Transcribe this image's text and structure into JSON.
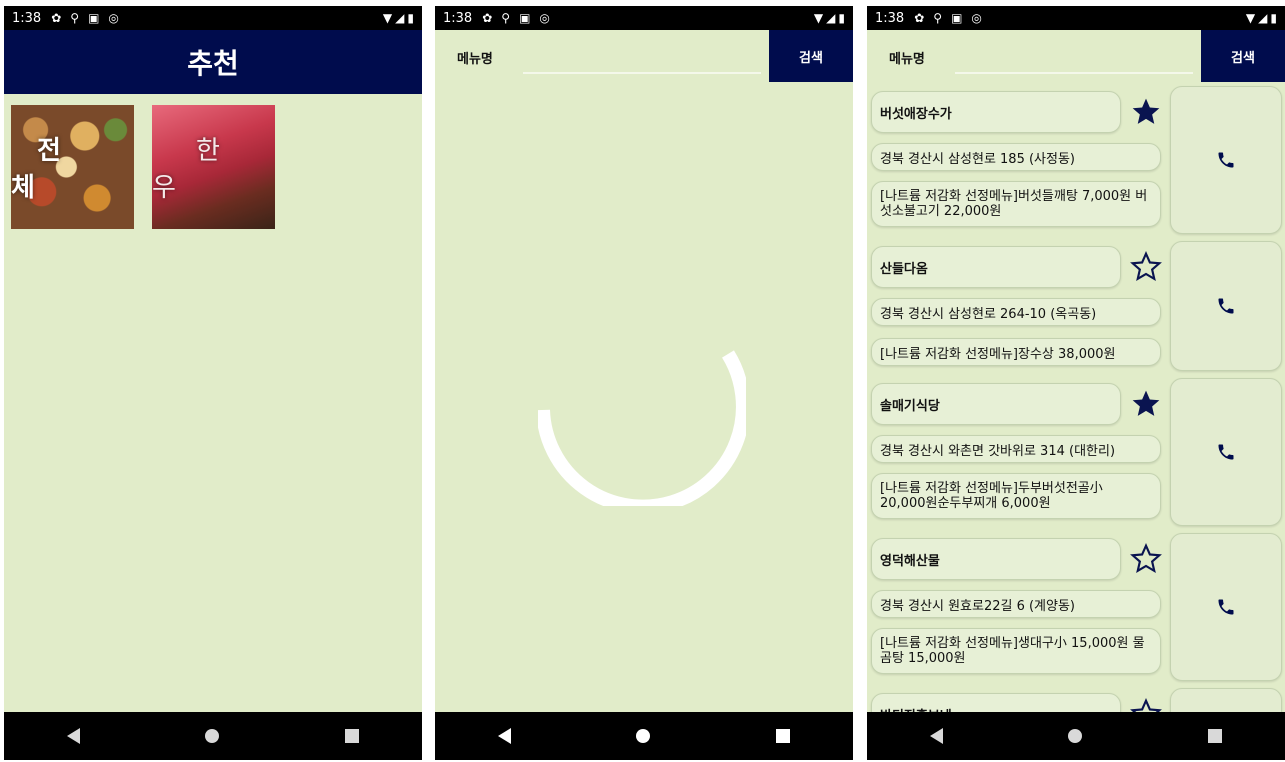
{
  "status": {
    "time": "1:38"
  },
  "colors": {
    "appbar": "#000c4d",
    "background": "#e1ecc9",
    "star_filled": "#0a1450"
  },
  "screen1": {
    "title": "추천",
    "tiles": [
      {
        "label": "전체"
      },
      {
        "label": "한우"
      }
    ]
  },
  "search": {
    "label": "메뉴명",
    "input_value": "",
    "button_label": "검색"
  },
  "restaurants": [
    {
      "name": "버섯애장수가",
      "address": "경북 경산시 삼성현로 185 (사정동)",
      "menu": "[나트륨 저감화 선정메뉴]버섯들깨탕 7,000원 버섯소불고기 22,000원",
      "favorite": true
    },
    {
      "name": "산들다옴",
      "address": "경북 경산시 삼성현로 264-10 (옥곡동)",
      "menu": "[나트륨 저감화 선정메뉴]장수상 38,000원",
      "favorite": false
    },
    {
      "name": "솔매기식당",
      "address": "경북 경산시 와촌면 갓바위로 314 (대한리)",
      "menu": "[나트륨 저감화 선정메뉴]두부버섯전골小 20,000원순두부찌개 6,000원",
      "favorite": true
    },
    {
      "name": "영덕해산물",
      "address": "경북 경산시 원효로22길 6 (계양동)",
      "menu": "[나트륨 저감화 선정메뉴]생대구小 15,000원 물곰탕 15,000원",
      "favorite": false
    },
    {
      "name": "반디진홍보네",
      "favorite": false
    }
  ]
}
